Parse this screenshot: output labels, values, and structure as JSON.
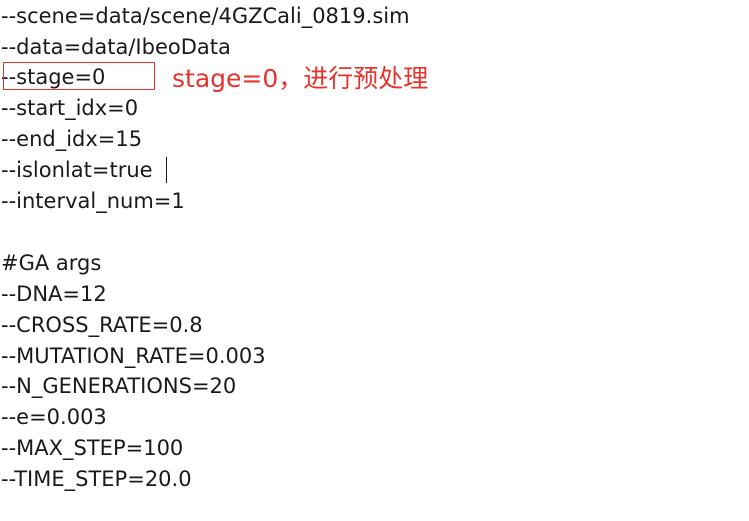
{
  "editor": {
    "lines": [
      "--scene=data/scene/4GZCali_0819.sim",
      "--data=data/IbeoData",
      "--stage=0",
      "--start_idx=0",
      "--end_idx=15",
      "--islonlat=true",
      "--interval_num=1",
      "",
      "#GA args",
      "--DNA=12",
      "--CROSS_RATE=0.8",
      "--MUTATION_RATE=0.003",
      "--N_GENERATIONS=20",
      "--e=0.003",
      "--MAX_STEP=100",
      "--TIME_STEP=20.0"
    ]
  },
  "annotation": {
    "text": "stage=0，进行预处理",
    "color": "#e8322c"
  }
}
